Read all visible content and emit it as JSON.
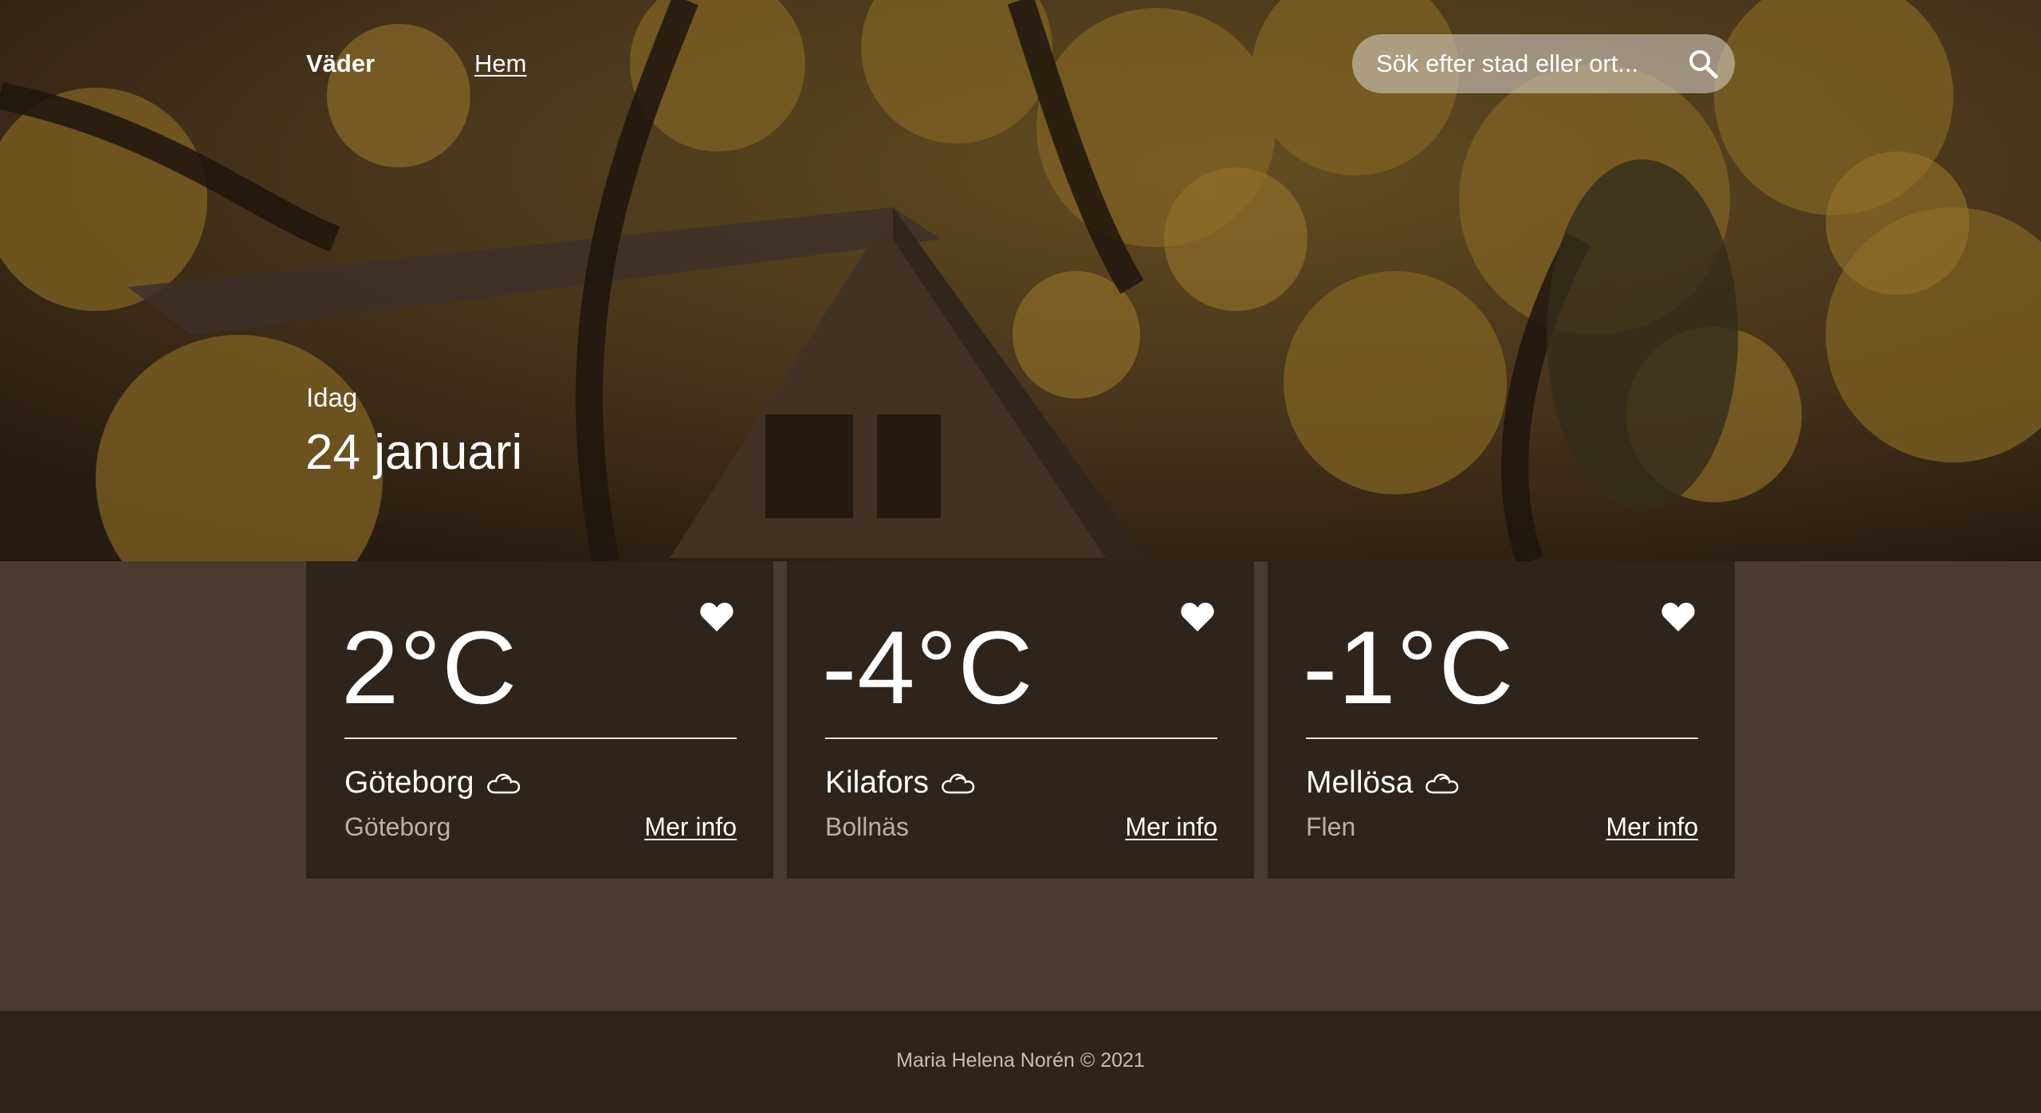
{
  "nav": {
    "brand": "Väder",
    "home_link": "Hem"
  },
  "search": {
    "placeholder": "Sök efter stad eller ort...",
    "icon": "search-icon"
  },
  "today": {
    "label": "Idag",
    "date": "24 januari"
  },
  "cards": [
    {
      "temperature": "2°C",
      "city": "Göteborg",
      "region": "Göteborg",
      "link": "Mer info",
      "weather_icon": "cloud-icon",
      "favorite_icon": "heart-icon"
    },
    {
      "temperature": "-4°C",
      "city": "Kilafors",
      "region": "Bollnäs",
      "link": "Mer info",
      "weather_icon": "cloud-icon",
      "favorite_icon": "heart-icon"
    },
    {
      "temperature": "-1°C",
      "city": "Mellösa",
      "region": "Flen",
      "link": "Mer info",
      "weather_icon": "cloud-icon",
      "favorite_icon": "heart-icon"
    }
  ],
  "footer": {
    "text": "Maria Helena Norén © 2021"
  },
  "colors": {
    "page_background": "#4a3b30",
    "card_background": "#2e241c",
    "footer_background": "#2e241c",
    "region_text": "#b9b0a7"
  }
}
